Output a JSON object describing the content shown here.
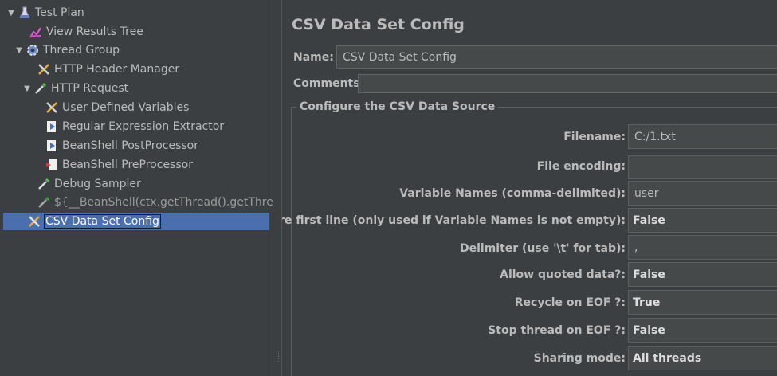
{
  "tree": {
    "items": [
      {
        "label": "Test Plan",
        "icon": "flask-icon",
        "expanded": true
      },
      {
        "label": "View Results Tree",
        "icon": "chart-icon"
      },
      {
        "label": "Thread Group",
        "icon": "gear-icon",
        "expanded": true
      },
      {
        "label": "HTTP Header Manager",
        "icon": "wrench-scissors-icon"
      },
      {
        "label": "HTTP Request",
        "icon": "pipette-icon",
        "expanded": true
      },
      {
        "label": "User Defined Variables",
        "icon": "wrench-scissors-icon"
      },
      {
        "label": "Regular Expression Extractor",
        "icon": "post-processor-icon"
      },
      {
        "label": "BeanShell PostProcessor",
        "icon": "post-processor-icon"
      },
      {
        "label": "BeanShell PreProcessor",
        "icon": "pre-processor-icon"
      },
      {
        "label": "Debug Sampler",
        "icon": "pipette-icon"
      },
      {
        "label": "${__BeanShell(ctx.getThread().getThre",
        "icon": "pipette-icon",
        "disabled": true
      },
      {
        "label": "CSV Data Set Config",
        "icon": "wrench-scissors-icon",
        "selected": true
      }
    ]
  },
  "panel": {
    "title": "CSV Data Set Config",
    "name_label": "Name:",
    "name_value": "CSV Data Set Config",
    "comments_label": "Comments:",
    "comments_value": "",
    "group_title": "Configure the CSV Data Source",
    "fields": [
      {
        "label": "Filename:",
        "value": "C:/1.txt"
      },
      {
        "label": "File encoding:",
        "value": ""
      },
      {
        "label": "Variable Names (comma-delimited):",
        "value": "user"
      },
      {
        "label": "Ignore first line (only used if Variable Names is not empty):",
        "value": "False"
      },
      {
        "label": "Delimiter (use '\\t' for tab):",
        "value": ","
      },
      {
        "label": "Allow quoted data?:",
        "value": "False"
      },
      {
        "label": "Recycle on EOF ?:",
        "value": "True"
      },
      {
        "label": "Stop thread on EOF ?:",
        "value": "False"
      },
      {
        "label": "Sharing mode:",
        "value": "All threads"
      }
    ]
  },
  "colors": {
    "background": "#3c3f41",
    "selection": "#4b6eaf",
    "field": "#45494a",
    "text": "#bbbbbb"
  }
}
